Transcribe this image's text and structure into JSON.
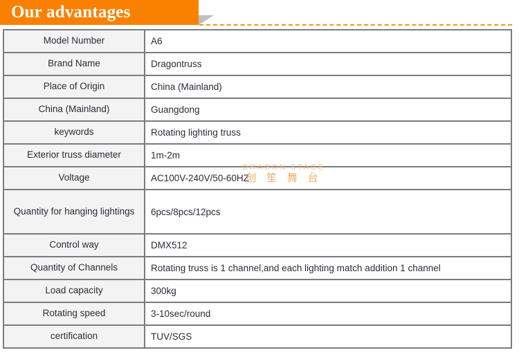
{
  "banner": {
    "title": "Our advantages",
    "background_color": "#fa8100",
    "text_color": "#ffffff",
    "dash_rule_color": "#f7931e",
    "fold_color": "#bfbfbf"
  },
  "watermark": {
    "english": "DRAGON STAGE",
    "chinese": "创 笙 舞 台",
    "color": "#f0a04b"
  },
  "table": {
    "label_background": "#f3f3f3",
    "value_background": "#ffffff",
    "border_color": "#7b7b7b",
    "rows": [
      {
        "label": "Model Number",
        "value": "A6",
        "tall": false
      },
      {
        "label": "Brand Name",
        "value": "Dragontruss",
        "tall": false
      },
      {
        "label": "Place of Origin",
        "value": "China (Mainland)",
        "tall": false
      },
      {
        "label": "China (Mainland)",
        "value": "Guangdong",
        "tall": false
      },
      {
        "label": "keywords",
        "value": "Rotating lighting truss",
        "tall": false
      },
      {
        "label": "Exterior truss diameter",
        "value": "1m-2m",
        "tall": false
      },
      {
        "label": "Voltage",
        "value": "AC100V-240V/50-60HZ",
        "tall": false
      },
      {
        "label": "Quantity for hanging lightings",
        "value": "6pcs/8pcs/12pcs",
        "tall": true
      },
      {
        "label": "Control way",
        "value": "DMX512",
        "tall": false
      },
      {
        "label": "Quantity of Channels",
        "value": "Rotating truss is 1 channel,and each lighting match addition 1 channel",
        "tall": false
      },
      {
        "label": "Load capacity",
        "value": "300kg",
        "tall": false
      },
      {
        "label": "Rotating speed",
        "value": "3-10sec/round",
        "tall": false
      },
      {
        "label": "certification",
        "value": "TUV/SGS",
        "tall": false
      }
    ]
  }
}
